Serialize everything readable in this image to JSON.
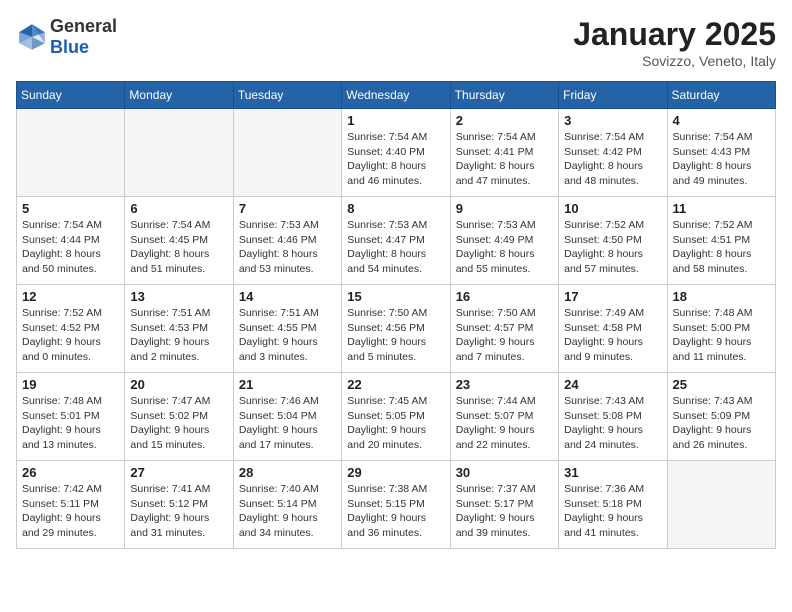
{
  "header": {
    "logo_general": "General",
    "logo_blue": "Blue",
    "month_year": "January 2025",
    "location": "Sovizzo, Veneto, Italy"
  },
  "weekdays": [
    "Sunday",
    "Monday",
    "Tuesday",
    "Wednesday",
    "Thursday",
    "Friday",
    "Saturday"
  ],
  "weeks": [
    [
      {
        "day": "",
        "empty": true
      },
      {
        "day": "",
        "empty": true
      },
      {
        "day": "",
        "empty": true
      },
      {
        "day": "1",
        "sunrise": "7:54 AM",
        "sunset": "4:40 PM",
        "daylight": "8 hours and 46 minutes."
      },
      {
        "day": "2",
        "sunrise": "7:54 AM",
        "sunset": "4:41 PM",
        "daylight": "8 hours and 47 minutes."
      },
      {
        "day": "3",
        "sunrise": "7:54 AM",
        "sunset": "4:42 PM",
        "daylight": "8 hours and 48 minutes."
      },
      {
        "day": "4",
        "sunrise": "7:54 AM",
        "sunset": "4:43 PM",
        "daylight": "8 hours and 49 minutes."
      }
    ],
    [
      {
        "day": "5",
        "sunrise": "7:54 AM",
        "sunset": "4:44 PM",
        "daylight": "8 hours and 50 minutes."
      },
      {
        "day": "6",
        "sunrise": "7:54 AM",
        "sunset": "4:45 PM",
        "daylight": "8 hours and 51 minutes."
      },
      {
        "day": "7",
        "sunrise": "7:53 AM",
        "sunset": "4:46 PM",
        "daylight": "8 hours and 53 minutes."
      },
      {
        "day": "8",
        "sunrise": "7:53 AM",
        "sunset": "4:47 PM",
        "daylight": "8 hours and 54 minutes."
      },
      {
        "day": "9",
        "sunrise": "7:53 AM",
        "sunset": "4:49 PM",
        "daylight": "8 hours and 55 minutes."
      },
      {
        "day": "10",
        "sunrise": "7:52 AM",
        "sunset": "4:50 PM",
        "daylight": "8 hours and 57 minutes."
      },
      {
        "day": "11",
        "sunrise": "7:52 AM",
        "sunset": "4:51 PM",
        "daylight": "8 hours and 58 minutes."
      }
    ],
    [
      {
        "day": "12",
        "sunrise": "7:52 AM",
        "sunset": "4:52 PM",
        "daylight": "9 hours and 0 minutes."
      },
      {
        "day": "13",
        "sunrise": "7:51 AM",
        "sunset": "4:53 PM",
        "daylight": "9 hours and 2 minutes."
      },
      {
        "day": "14",
        "sunrise": "7:51 AM",
        "sunset": "4:55 PM",
        "daylight": "9 hours and 3 minutes."
      },
      {
        "day": "15",
        "sunrise": "7:50 AM",
        "sunset": "4:56 PM",
        "daylight": "9 hours and 5 minutes."
      },
      {
        "day": "16",
        "sunrise": "7:50 AM",
        "sunset": "4:57 PM",
        "daylight": "9 hours and 7 minutes."
      },
      {
        "day": "17",
        "sunrise": "7:49 AM",
        "sunset": "4:58 PM",
        "daylight": "9 hours and 9 minutes."
      },
      {
        "day": "18",
        "sunrise": "7:48 AM",
        "sunset": "5:00 PM",
        "daylight": "9 hours and 11 minutes."
      }
    ],
    [
      {
        "day": "19",
        "sunrise": "7:48 AM",
        "sunset": "5:01 PM",
        "daylight": "9 hours and 13 minutes."
      },
      {
        "day": "20",
        "sunrise": "7:47 AM",
        "sunset": "5:02 PM",
        "daylight": "9 hours and 15 minutes."
      },
      {
        "day": "21",
        "sunrise": "7:46 AM",
        "sunset": "5:04 PM",
        "daylight": "9 hours and 17 minutes."
      },
      {
        "day": "22",
        "sunrise": "7:45 AM",
        "sunset": "5:05 PM",
        "daylight": "9 hours and 20 minutes."
      },
      {
        "day": "23",
        "sunrise": "7:44 AM",
        "sunset": "5:07 PM",
        "daylight": "9 hours and 22 minutes."
      },
      {
        "day": "24",
        "sunrise": "7:43 AM",
        "sunset": "5:08 PM",
        "daylight": "9 hours and 24 minutes."
      },
      {
        "day": "25",
        "sunrise": "7:43 AM",
        "sunset": "5:09 PM",
        "daylight": "9 hours and 26 minutes."
      }
    ],
    [
      {
        "day": "26",
        "sunrise": "7:42 AM",
        "sunset": "5:11 PM",
        "daylight": "9 hours and 29 minutes."
      },
      {
        "day": "27",
        "sunrise": "7:41 AM",
        "sunset": "5:12 PM",
        "daylight": "9 hours and 31 minutes."
      },
      {
        "day": "28",
        "sunrise": "7:40 AM",
        "sunset": "5:14 PM",
        "daylight": "9 hours and 34 minutes."
      },
      {
        "day": "29",
        "sunrise": "7:38 AM",
        "sunset": "5:15 PM",
        "daylight": "9 hours and 36 minutes."
      },
      {
        "day": "30",
        "sunrise": "7:37 AM",
        "sunset": "5:17 PM",
        "daylight": "9 hours and 39 minutes."
      },
      {
        "day": "31",
        "sunrise": "7:36 AM",
        "sunset": "5:18 PM",
        "daylight": "9 hours and 41 minutes."
      },
      {
        "day": "",
        "empty": true
      }
    ]
  ]
}
